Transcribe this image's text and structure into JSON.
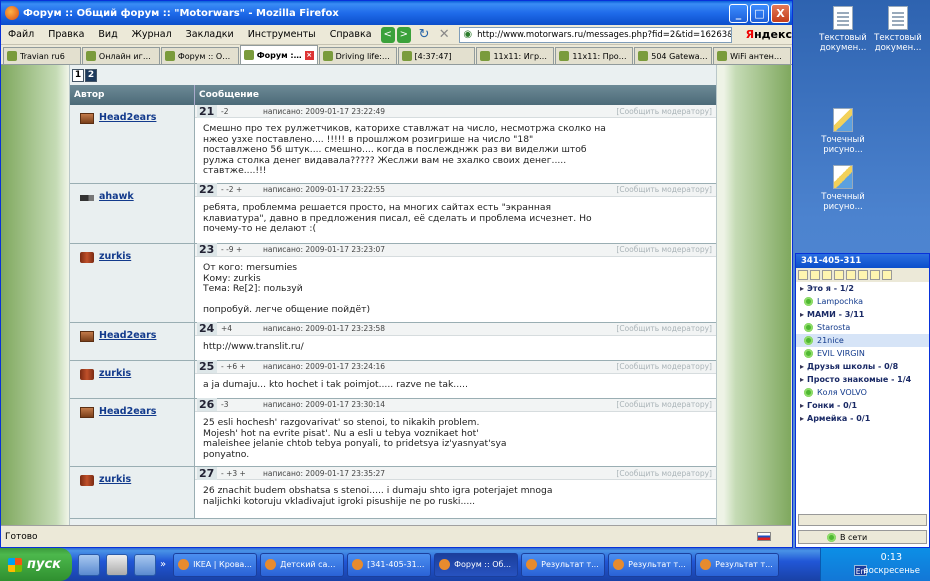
{
  "window": {
    "title": "Форум :: Общий форум :: \"Motorwars\" - Mozilla Firefox",
    "minimize": "_",
    "maximize": "□",
    "close": "X"
  },
  "menu": {
    "items": [
      "Файл",
      "Правка",
      "Вид",
      "Журнал",
      "Закладки",
      "Инструменты",
      "Справка"
    ],
    "back": "<",
    "forward": ">",
    "reload": "↻",
    "stop": "✕"
  },
  "address": {
    "url": "http://www.motorwars.ru/messages.php?fid=2&tid=16263&page_id=1"
  },
  "search": {
    "brand_first": "Я",
    "brand_rest": "ндекс"
  },
  "tabs": [
    {
      "label": "Travian ru6",
      "active": false
    },
    {
      "label": "Онлайн игра...",
      "active": false
    },
    {
      "label": "Форум :: Об...",
      "active": false
    },
    {
      "label": "Форум :: ...",
      "active": true
    },
    {
      "label": "Driving life:д...",
      "active": false
    },
    {
      "label": "[4:37:47]",
      "active": false
    },
    {
      "label": "11x11: Игро...",
      "active": false
    },
    {
      "label": "11x11: Проф...",
      "active": false
    },
    {
      "label": "504 Gateway ...",
      "active": false
    },
    {
      "label": "WiFi антенна...",
      "active": false
    }
  ],
  "pager": {
    "pages": [
      "1",
      "2"
    ],
    "current": "2"
  },
  "table": {
    "col_author": "Автор",
    "col_message": "Сообщение"
  },
  "posts": [
    {
      "num": "21",
      "rating": "-2",
      "posted": "написано: 2009-01-17 23:22:49",
      "report": "[Сообщить модератору]",
      "author": "Head2ears",
      "avatar": "h2e",
      "text": "Смешно про тех рулжетчиков, каторихе ставлжат на число, несмотржа сколко на\nнжео узхе поставлено.... !!!!! в прошлжом розигрише на число \"18\"\nпоставлжено 56 штук.... смешно.... когда в послежднжк раз ви виделжи штоб\nрулжа столка денег видавала????? Жеслжи вам не зхалко своих денег.....\nставтже....!!!"
    },
    {
      "num": "22",
      "rating": "- -2 +",
      "posted": "написано: 2009-01-17 23:22:55",
      "report": "[Сообщить модератору]",
      "author": "ahawk",
      "avatar": "gun",
      "text": "ребята, проблемма решается просто, на многих сайтах есть \"экранная\nклавиатура\", давно в предложения писал, её сделать и проблема исчезнет. Но\nпочему-то не делают :("
    },
    {
      "num": "23",
      "rating": "- -9 +",
      "posted": "написано: 2009-01-17 23:23:07",
      "report": "[Сообщить модератору]",
      "author": "zurkis",
      "avatar": "zur",
      "text": "От кого: mersumies\nКому: zurkis\nТема: Re[2]: пользуй\n\nпопробуй. легче общение пойдёт)"
    },
    {
      "num": "24",
      "rating": "+4",
      "posted": "написано: 2009-01-17 23:23:58",
      "report": "[Сообщить модератору]",
      "author": "Head2ears",
      "avatar": "h2e",
      "text": "http://www.translit.ru/"
    },
    {
      "num": "25",
      "rating": "- +6 +",
      "posted": "написано: 2009-01-17 23:24:16",
      "report": "[Сообщить модератору]",
      "author": "zurkis",
      "avatar": "zur",
      "text": "a ja dumaju... kto hochet i tak poimjot..... razve ne tak....."
    },
    {
      "num": "26",
      "rating": "-3",
      "posted": "написано: 2009-01-17 23:30:14",
      "report": "[Сообщить модератору]",
      "author": "Head2ears",
      "avatar": "h2e",
      "text": "25 esli hochesh' razgovarivat' so stenoi, to nikakih problem.\nMojesh' hot na evrite pisat'. Nu a esli u tebya voznikaet hot'\nmaleishee jelanie chtob tebya ponyali, to pridetsya iz'yasnyat'sya\nponyatno."
    },
    {
      "num": "27",
      "rating": "- +3 +",
      "posted": "написано: 2009-01-17 23:35:27",
      "report": "[Сообщить модератору]",
      "author": "zurkis",
      "avatar": "zur",
      "text": "26 znachit budem obshatsa s stenoi..... i dumaju shto igra poterjajet mnoga\nnaljichki kotoruju vkladivajut igroki pisushije ne po ruski....."
    }
  ],
  "status": {
    "text": "Готово"
  },
  "desktop_icons": [
    {
      "label": "Текстовый докумен...",
      "kind": "doc"
    },
    {
      "label": "Текстовый докумен...",
      "kind": "doc"
    },
    {
      "label": "Точечный рисуно...",
      "kind": "paint"
    },
    {
      "label": "Точечный рисуно...",
      "kind": "paint"
    }
  ],
  "icq": {
    "title": "341-405-311",
    "rows": [
      {
        "type": "group",
        "label": "Это я - 1/2"
      },
      {
        "type": "contact",
        "label": "Lampochka",
        "online": true
      },
      {
        "type": "group",
        "label": "МАМИ - 3/11"
      },
      {
        "type": "contact",
        "label": "Starosta",
        "online": true
      },
      {
        "type": "contact",
        "label": "21nice",
        "online": true,
        "selected": true
      },
      {
        "type": "contact",
        "label": "EVIL VIRGIN",
        "online": true
      },
      {
        "type": "group",
        "label": "Друзья школы - 0/8"
      },
      {
        "type": "group",
        "label": "Просто знакомые - 1/4"
      },
      {
        "type": "contact",
        "label": "Коля VOLVO",
        "online": true
      },
      {
        "type": "group",
        "label": "Гонки - 0/1"
      },
      {
        "type": "group",
        "label": "Армейка - 0/1"
      }
    ],
    "status_label": "В сети"
  },
  "taskbar": {
    "start": "пуск",
    "tasks": [
      {
        "label": "IKEA | Крова...",
        "active": false
      },
      {
        "label": "Детский сад...",
        "active": false
      },
      {
        "label": "[341-405-31...",
        "active": false
      },
      {
        "label": "Форум :: Об...",
        "active": true
      },
      {
        "label": "Результат т...",
        "active": false
      },
      {
        "label": "Результат т...",
        "active": false
      },
      {
        "label": "Результат т...",
        "active": false
      }
    ],
    "expand": "»",
    "time": "0:13",
    "day": "воскресенье",
    "lang": "En"
  }
}
